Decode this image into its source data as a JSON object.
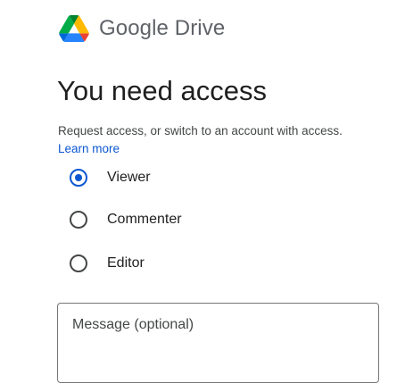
{
  "header": {
    "brand": "Google Drive",
    "logo_icon": "google-drive-logo-icon"
  },
  "main": {
    "title": "You need access",
    "subtitle": "Request access, or switch to an account with access.",
    "learn_more": "Learn more"
  },
  "roles": {
    "selected": "Viewer",
    "options": [
      {
        "label": "Viewer",
        "checked": true
      },
      {
        "label": "Commenter",
        "checked": false
      },
      {
        "label": "Editor",
        "checked": false
      }
    ]
  },
  "message": {
    "placeholder": "Message (optional)",
    "value": ""
  },
  "colors": {
    "accent": "#0b57d0",
    "text": "#1f1f1f",
    "secondary_text": "#444746",
    "border": "#747775"
  }
}
